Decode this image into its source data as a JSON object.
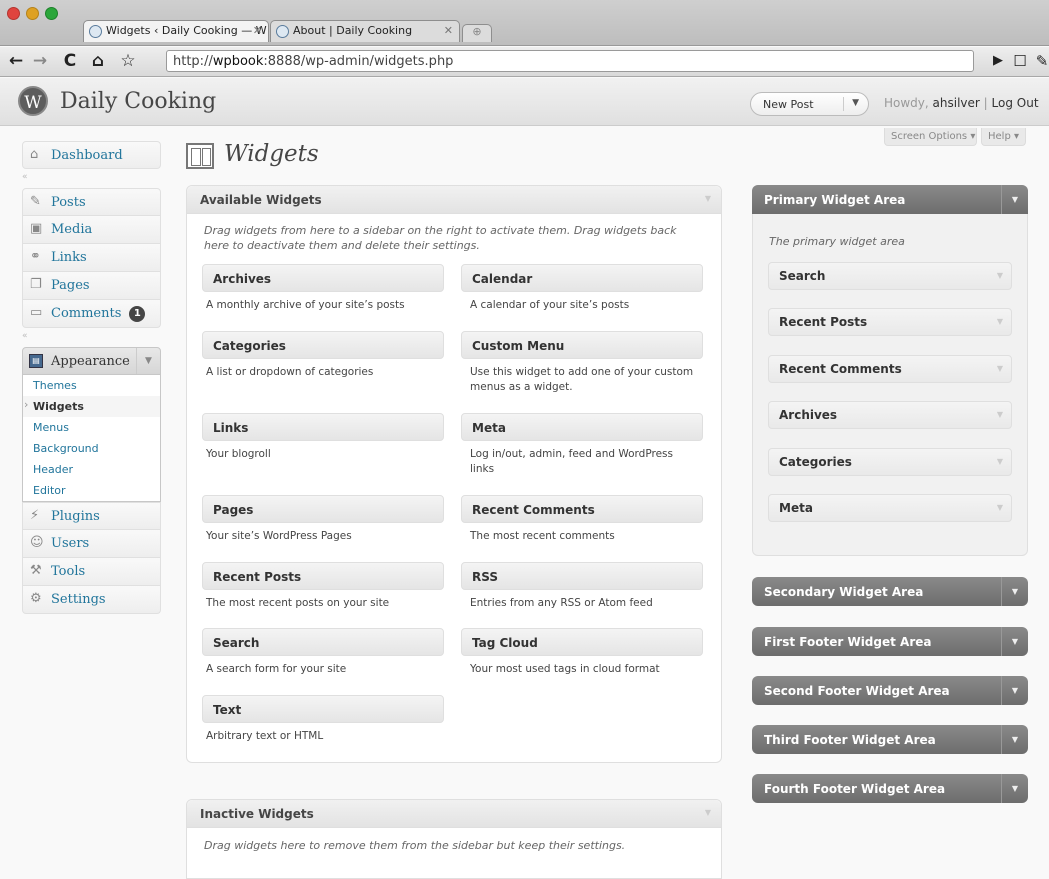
{
  "browser": {
    "tabs": [
      {
        "title": "Widgets ‹ Daily Cooking — W",
        "active": true
      },
      {
        "title": "About | Daily Cooking",
        "active": false
      }
    ],
    "url_prefix": "http://",
    "url_host": "wpbook",
    "url_rest": ":8888/wp-admin/widgets.php"
  },
  "header": {
    "site_name": "Daily Cooking",
    "logo_letter": "W",
    "new_post": "New Post",
    "howdy": "Howdy,",
    "username": "ahsilver",
    "separator": "|",
    "logout": "Log Out",
    "screen_options": "Screen Options ▾",
    "help": "Help ▾"
  },
  "menu": {
    "dashboard": "Dashboard",
    "posts": "Posts",
    "media": "Media",
    "links": "Links",
    "pages": "Pages",
    "comments": "Comments",
    "comments_count": "1",
    "appearance": "Appearance",
    "appearance_sub": [
      "Themes",
      "Widgets",
      "Menus",
      "Background",
      "Header",
      "Editor"
    ],
    "plugins": "Plugins",
    "users": "Users",
    "tools": "Tools",
    "settings": "Settings"
  },
  "page": {
    "title": "Widgets"
  },
  "available": {
    "heading": "Available Widgets",
    "description": "Drag widgets from here to a sidebar on the right to activate them. Drag widgets back here to deactivate them and delete their settings.",
    "widgets": [
      {
        "name": "Archives",
        "desc": "A monthly archive of your site’s posts"
      },
      {
        "name": "Calendar",
        "desc": "A calendar of your site’s posts"
      },
      {
        "name": "Categories",
        "desc": "A list or dropdown of categories"
      },
      {
        "name": "Custom Menu",
        "desc": "Use this widget to add one of your custom menus as a widget."
      },
      {
        "name": "Links",
        "desc": "Your blogroll"
      },
      {
        "name": "Meta",
        "desc": "Log in/out, admin, feed and WordPress links"
      },
      {
        "name": "Pages",
        "desc": "Your site’s WordPress Pages"
      },
      {
        "name": "Recent Comments",
        "desc": "The most recent comments"
      },
      {
        "name": "Recent Posts",
        "desc": "The most recent posts on your site"
      },
      {
        "name": "RSS",
        "desc": "Entries from any RSS or Atom feed"
      },
      {
        "name": "Search",
        "desc": "A search form for your site"
      },
      {
        "name": "Tag Cloud",
        "desc": "Your most used tags in cloud format"
      },
      {
        "name": "Text",
        "desc": "Arbitrary text or HTML"
      }
    ]
  },
  "inactive": {
    "heading": "Inactive Widgets",
    "description": "Drag widgets here to remove them from the sidebar but keep their settings."
  },
  "sidebars": {
    "primary": {
      "title": "Primary Widget Area",
      "description": "The primary widget area",
      "widgets": [
        "Search",
        "Recent Posts",
        "Recent Comments",
        "Archives",
        "Categories",
        "Meta"
      ]
    },
    "secondary": "Secondary Widget Area",
    "first_footer": "First Footer Widget Area",
    "second_footer": "Second Footer Widget Area",
    "third_footer": "Third Footer Widget Area",
    "fourth_footer": "Fourth Footer Widget Area"
  }
}
